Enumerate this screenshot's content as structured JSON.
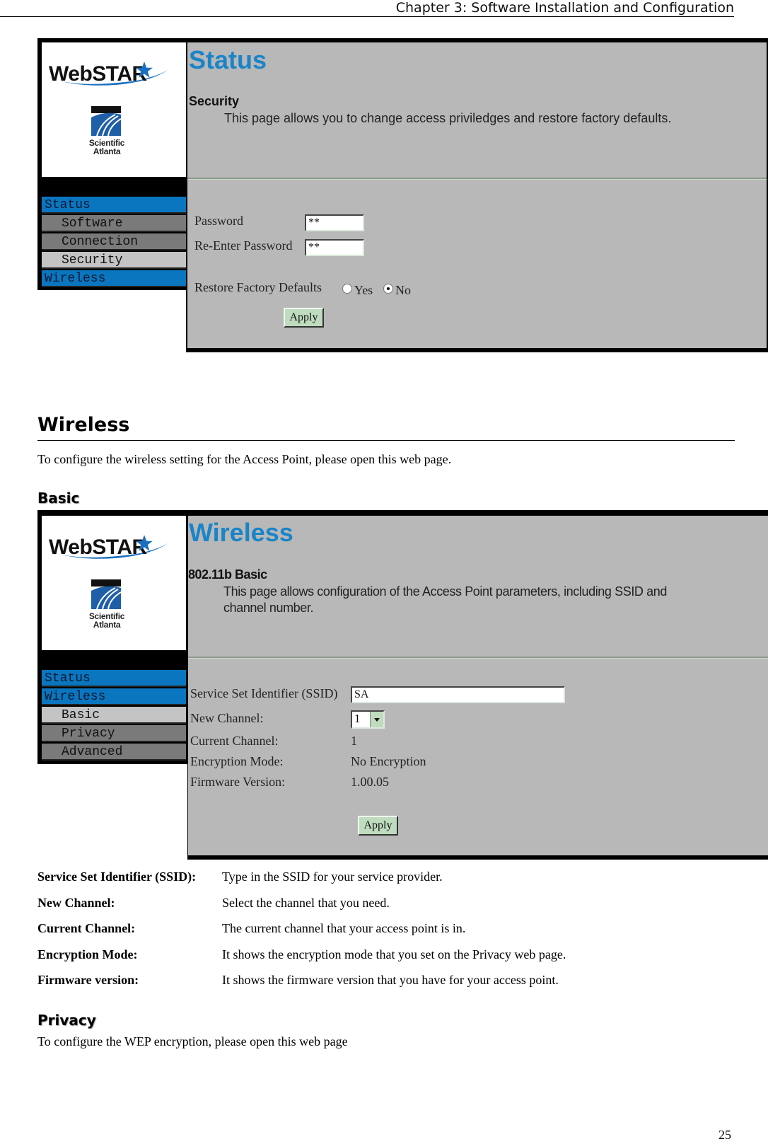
{
  "page_header": {
    "chapter": "Chapter 3: Software Installation and Configuration"
  },
  "screenshot_security": {
    "logo": {
      "brand": "WebSTAR",
      "company_line1": "Scientific",
      "company_line2": "Atlanta"
    },
    "nav": [
      {
        "label": "Status",
        "level": "top",
        "active": false
      },
      {
        "label": "Software",
        "level": "sub",
        "active": false
      },
      {
        "label": "Connection",
        "level": "sub",
        "active": false
      },
      {
        "label": "Security",
        "level": "sub",
        "active": true
      },
      {
        "label": "Wireless",
        "level": "top",
        "active": false
      }
    ],
    "title": "Status",
    "subtitle": "Security",
    "description": "This page allows you to change access priviledges and restore factory defaults.",
    "form": {
      "password_label": "Password",
      "password_value": "**",
      "reenter_label": "Re-Enter Password",
      "reenter_value": "**",
      "restore_label": "Restore Factory Defaults",
      "option_yes": "Yes",
      "option_no": "No",
      "selected": "No",
      "apply_label": "Apply"
    }
  },
  "section_wireless": {
    "heading": "Wireless",
    "intro": "To configure the wireless setting for the Access Point, please open this web page.",
    "basic_heading": "Basic"
  },
  "screenshot_wireless": {
    "logo": {
      "brand": "WebSTAR",
      "company_line1": "Scientific",
      "company_line2": "Atlanta"
    },
    "nav": [
      {
        "label": "Status",
        "level": "top",
        "active": false
      },
      {
        "label": "Wireless",
        "level": "top",
        "active": false
      },
      {
        "label": "Basic",
        "level": "sub",
        "active": true
      },
      {
        "label": "Privacy",
        "level": "sub",
        "active": false
      },
      {
        "label": "Advanced",
        "level": "sub",
        "active": false
      }
    ],
    "title": "Wireless",
    "subtitle": "802.11b Basic",
    "description_line1": "This page allows configuration of the Access Point parameters, including SSID and",
    "description_line2": "channel number.",
    "form": {
      "ssid_label": "Service Set Identifier (SSID)",
      "ssid_value": "SA",
      "new_channel_label": "New Channel:",
      "new_channel_value": "1",
      "current_channel_label": "Current Channel:",
      "current_channel_value": "1",
      "encryption_label": "Encryption Mode:",
      "encryption_value": "No Encryption",
      "firmware_label": "Firmware Version:",
      "firmware_value": "1.00.05",
      "apply_label": "Apply"
    }
  },
  "definitions": [
    {
      "term": "Service Set Identifier (SSID):",
      "desc": "Type in the SSID for your service provider."
    },
    {
      "term": "New Channel:",
      "desc": "Select the channel that you need."
    },
    {
      "term": "Current Channel:",
      "desc": "The current channel that your access point is in."
    },
    {
      "term": "Encryption Mode:",
      "desc": "It shows the encryption mode that you set on the Privacy web page."
    },
    {
      "term": "Firmware version:",
      "desc": "It shows the firmware version that you have for your access point."
    }
  ],
  "section_privacy": {
    "heading": "Privacy",
    "intro": "To configure the WEP encryption, please open this web page"
  },
  "page_number": "25",
  "colors": {
    "brand_blue": "#1a84c8",
    "nav_blue": "#0a76bf",
    "panel_gray": "#b8b8b8",
    "button_green": "#bfdcbf"
  }
}
